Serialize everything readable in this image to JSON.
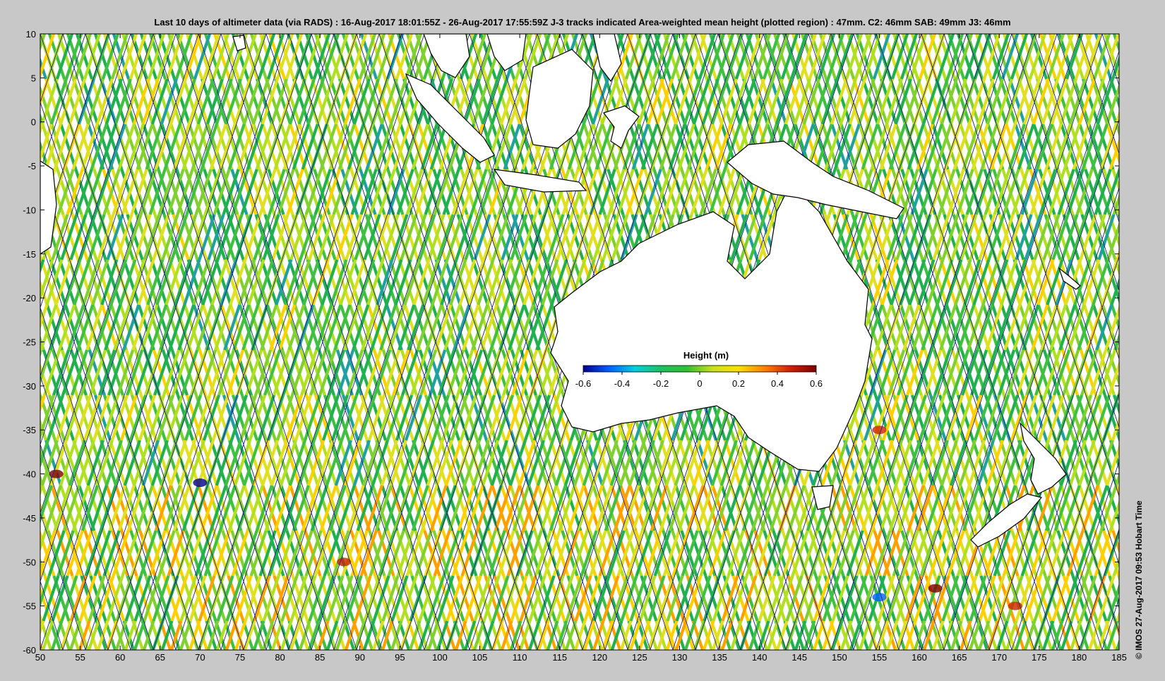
{
  "title": "Last 10 days of altimeter data (via RADS) : 16-Aug-2017 18:01:55Z - 26-Aug-2017 17:55:59Z  J-3 tracks indicated  Area-weighted mean height (plotted region) : 47mm.  C2: 46mm  SAB: 49mm  J3: 46mm",
  "credit": "© IMOS 27-Aug-2017 09:53 Hobart Time",
  "colorbar": {
    "title": "Height (m)",
    "tick_labels": [
      "-0.6",
      "-0.4",
      "-0.2",
      "0",
      "0.2",
      "0.4",
      "0.6"
    ],
    "colors": [
      "#00008f",
      "#0060ff",
      "#00d0e0",
      "#20c060",
      "#30c030",
      "#c8e020",
      "#ffe000",
      "#ff8000",
      "#d02000",
      "#7f0000"
    ]
  },
  "axes": {
    "x_ticks": [
      "50",
      "55",
      "60",
      "65",
      "70",
      "75",
      "80",
      "85",
      "90",
      "95",
      "100",
      "105",
      "110",
      "115",
      "120",
      "125",
      "130",
      "135",
      "140",
      "145",
      "150",
      "155",
      "160",
      "165",
      "170",
      "175",
      "180",
      "185"
    ],
    "y_ticks": [
      "10",
      "5",
      "0",
      "-5",
      "-10",
      "-15",
      "-20",
      "-25",
      "-30",
      "-35",
      "-40",
      "-45",
      "-50",
      "-55",
      "-60"
    ],
    "lon_range": [
      50,
      185
    ],
    "lat_range": [
      -60,
      10
    ]
  },
  "map": {
    "ocean_palette": [
      "#20b050",
      "#40c040",
      "#80d030",
      "#b0e020",
      "#e0e020",
      "#ffd000",
      "#ffa000",
      "#20a0a0"
    ],
    "track_color": "#202080",
    "land_color": "#ffffff"
  }
}
